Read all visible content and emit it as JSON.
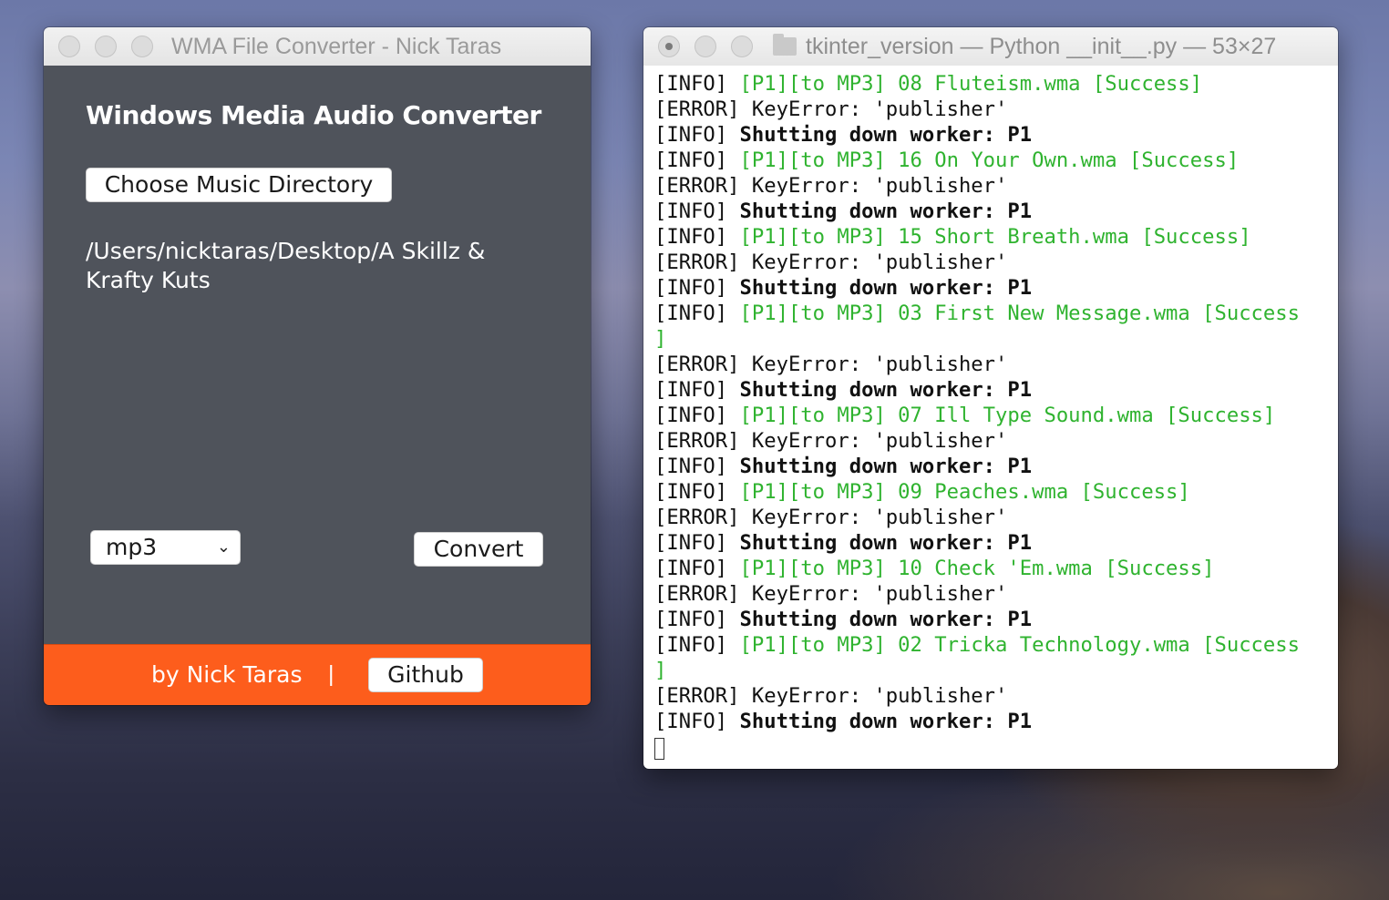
{
  "wma_window": {
    "title": "WMA File Converter - Nick Taras",
    "heading": "Windows Media Audio Converter",
    "choose_button": "Choose Music Directory",
    "selected_path": "/Users/nicktaras/Desktop/A Skillz & Krafty Kuts",
    "format_select": {
      "selected": "mp3"
    },
    "convert_button": "Convert",
    "footer": {
      "by": "by Nick Taras",
      "separator": "|",
      "github_button": "Github"
    }
  },
  "terminal_window": {
    "title": "tkinter_version — Python __init__.py — 53×27",
    "lines": [
      {
        "pre": "[INFO] ",
        "green": "[P1][to MP3] 08 Fluteism.wma [Success]"
      },
      {
        "pre": "[ERROR] KeyError: 'publisher'"
      },
      {
        "pre": "[INFO] ",
        "bold": "Shutting down worker: P1"
      },
      {
        "pre": "[INFO] ",
        "green": "[P1][to MP3] 16 On Your Own.wma [Success]"
      },
      {
        "pre": "[ERROR] KeyError: 'publisher'"
      },
      {
        "pre": "[INFO] ",
        "bold": "Shutting down worker: P1"
      },
      {
        "pre": "[INFO] ",
        "green": "[P1][to MP3] 15 Short Breath.wma [Success]"
      },
      {
        "pre": "[ERROR] KeyError: 'publisher'"
      },
      {
        "pre": "[INFO] ",
        "bold": "Shutting down worker: P1"
      },
      {
        "pre": "[INFO] ",
        "green": "[P1][to MP3] 03 First New Message.wma [Success"
      },
      {
        "green": "]"
      },
      {
        "pre": "[ERROR] KeyError: 'publisher'"
      },
      {
        "pre": "[INFO] ",
        "bold": "Shutting down worker: P1"
      },
      {
        "pre": "[INFO] ",
        "green": "[P1][to MP3] 07 Ill Type Sound.wma [Success]"
      },
      {
        "pre": "[ERROR] KeyError: 'publisher'"
      },
      {
        "pre": "[INFO] ",
        "bold": "Shutting down worker: P1"
      },
      {
        "pre": "[INFO] ",
        "green": "[P1][to MP3] 09 Peaches.wma [Success]"
      },
      {
        "pre": "[ERROR] KeyError: 'publisher'"
      },
      {
        "pre": "[INFO] ",
        "bold": "Shutting down worker: P1"
      },
      {
        "pre": "[INFO] ",
        "green": "[P1][to MP3] 10 Check 'Em.wma [Success]"
      },
      {
        "pre": "[ERROR] KeyError: 'publisher'"
      },
      {
        "pre": "[INFO] ",
        "bold": "Shutting down worker: P1"
      },
      {
        "pre": "[INFO] ",
        "green": "[P1][to MP3] 02 Tricka Technology.wma [Success"
      },
      {
        "green": "]"
      },
      {
        "pre": "[ERROR] KeyError: 'publisher'"
      },
      {
        "pre": "[INFO] ",
        "bold": "Shutting down worker: P1"
      }
    ]
  },
  "colors": {
    "footer_orange": "#fd5d1c",
    "app_body": "#4f535b",
    "terminal_green": "#2fb32f"
  }
}
